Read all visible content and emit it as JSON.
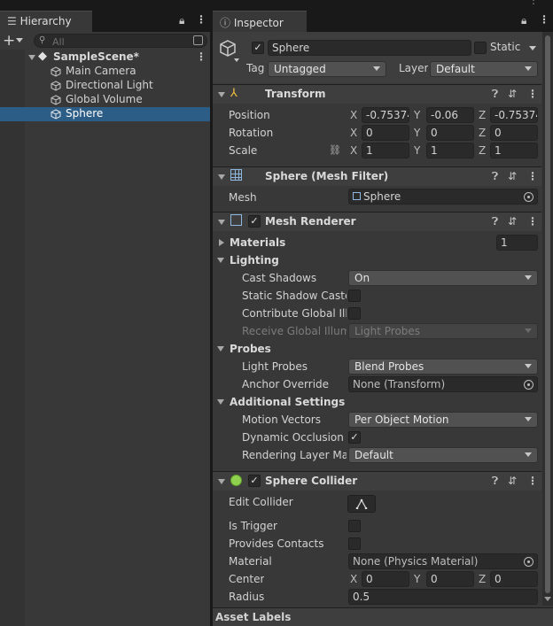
{
  "hierarchy": {
    "tab_label": "Hierarchy",
    "add_label": "+",
    "search_placeholder": "All",
    "scene": "SampleScene*",
    "items": [
      "Main Camera",
      "Directional Light",
      "Global Volume",
      "Sphere"
    ],
    "selected": "Sphere"
  },
  "inspector": {
    "tab_label": "Inspector",
    "object_name": "Sphere",
    "active": true,
    "static_label": "Static",
    "tag_label": "Tag",
    "tag_value": "Untagged",
    "layer_label": "Layer",
    "layer_value": "Default"
  },
  "transform": {
    "title": "Transform",
    "position_label": "Position",
    "rotation_label": "Rotation",
    "scale_label": "Scale",
    "position": {
      "x": "-0.75374",
      "y": "-0.06",
      "z": "-0.75374"
    },
    "rotation": {
      "x": "0",
      "y": "0",
      "z": "0"
    },
    "scale": {
      "x": "1",
      "y": "1",
      "z": "1"
    },
    "axes": {
      "x": "X",
      "y": "Y",
      "z": "Z"
    }
  },
  "mesh_filter": {
    "title": "Sphere (Mesh Filter)",
    "mesh_label": "Mesh",
    "mesh_value": "Sphere"
  },
  "mesh_renderer": {
    "title": "Mesh Renderer",
    "enabled": true,
    "materials_label": "Materials",
    "materials_count": "1",
    "lighting_label": "Lighting",
    "cast_shadows_label": "Cast Shadows",
    "cast_shadows_value": "On",
    "static_shadow_label": "Static Shadow Caste",
    "static_shadow": false,
    "contribute_gi_label": "Contribute Global Illu",
    "contribute_gi": false,
    "receive_gi_label": "Receive Global Illumi",
    "receive_gi_value": "Light Probes",
    "probes_label": "Probes",
    "light_probes_label": "Light Probes",
    "light_probes_value": "Blend Probes",
    "anchor_override_label": "Anchor Override",
    "anchor_override_value": "None (Transform)",
    "additional_label": "Additional Settings",
    "motion_vectors_label": "Motion Vectors",
    "motion_vectors_value": "Per Object Motion",
    "dynamic_occlusion_label": "Dynamic Occlusion",
    "dynamic_occlusion": true,
    "rendering_layer_label": "Rendering Layer Mas",
    "rendering_layer_value": "Default"
  },
  "sphere_collider": {
    "title": "Sphere Collider",
    "enabled": true,
    "edit_collider_label": "Edit Collider",
    "is_trigger_label": "Is Trigger",
    "is_trigger": false,
    "provides_contacts_label": "Provides Contacts",
    "provides_contacts": false,
    "material_label": "Material",
    "material_value": "None (Physics Material)",
    "center_label": "Center",
    "center": {
      "x": "0",
      "y": "0",
      "z": "0"
    },
    "radius_label": "Radius",
    "radius_value": "0.5"
  },
  "asset_labels": "Asset Labels",
  "colors": {
    "selection": "#2c5d87",
    "panel": "#383838",
    "field": "#2a2a2a",
    "dropdown": "#515151",
    "collider_icon": "#8fd14f"
  }
}
